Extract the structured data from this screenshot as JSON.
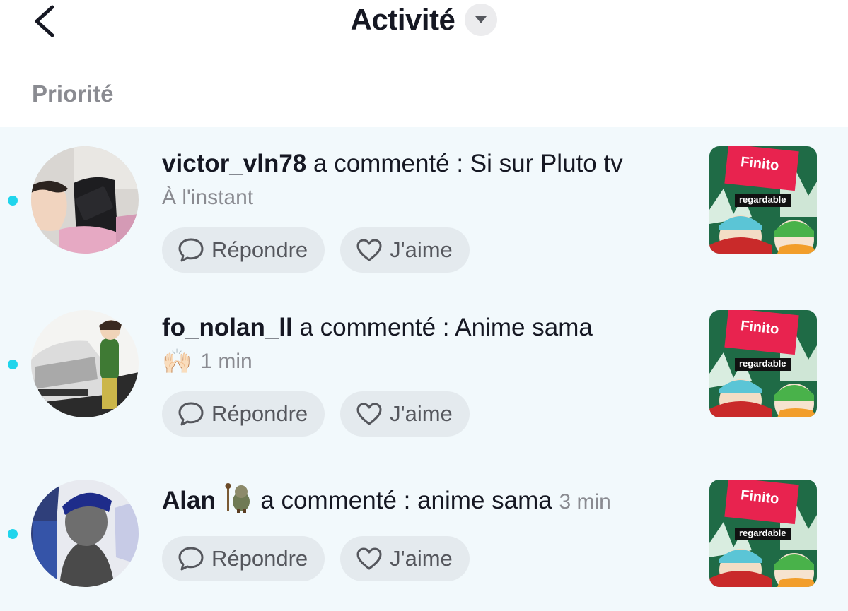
{
  "header": {
    "title": "Activité",
    "back_icon": "chevron-left-icon",
    "dropdown_icon": "caret-down-icon"
  },
  "section": {
    "label": "Priorité"
  },
  "colors": {
    "unread_dot": "#20d5ec",
    "list_bg": "#f2f9fc",
    "pill_bg": "#e4eaee",
    "muted": "#8a8b91"
  },
  "notifications": [
    {
      "username": "victor_vln78",
      "action": "a commenté : Si sur Pluto tv",
      "time": "À l'instant",
      "reply_label": "Répondre",
      "like_label": "J'aime",
      "thumb_text_1": "Finito",
      "thumb_text_2": "regardable"
    },
    {
      "username": "fo_nolan_ll",
      "action": "a commenté : Anime sama",
      "emoji": "🙌🏻",
      "time": "1 min",
      "reply_label": "Répondre",
      "like_label": "J'aime",
      "thumb_text_1": "Finito",
      "thumb_text_2": "regardable"
    },
    {
      "username": "Alan",
      "action": "a commenté : anime sama",
      "time": "3 min",
      "reply_label": "Répondre",
      "like_label": "J'aime",
      "thumb_text_1": "Finito",
      "thumb_text_2": "regardable"
    }
  ]
}
